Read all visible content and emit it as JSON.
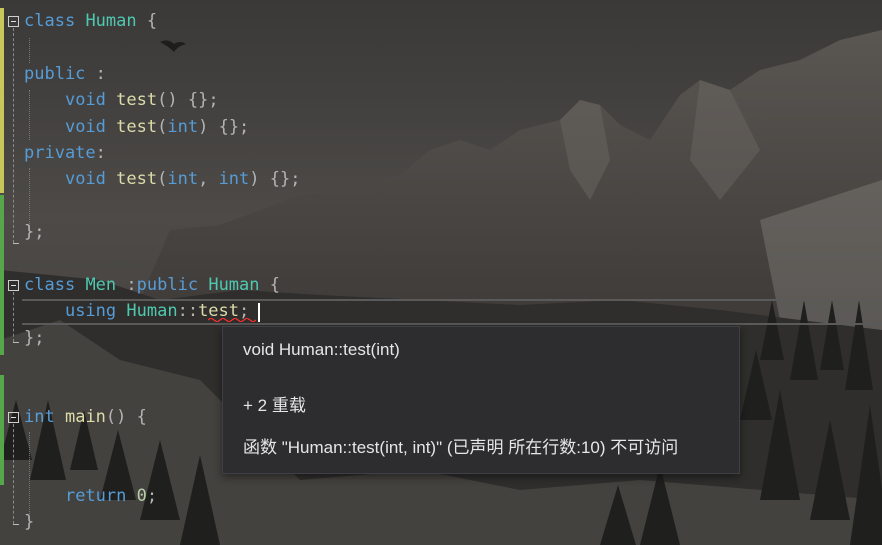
{
  "code": {
    "kw_class": "class",
    "kw_public": "public",
    "kw_private": "private",
    "kw_void": "void",
    "kw_int": "int",
    "kw_using": "using",
    "kw_return": "return",
    "type_human": "Human",
    "type_men": "Men",
    "fn_test": "test",
    "fn_main": "main",
    "num_zero": "0",
    "brace_open": "{",
    "brace_close": "};",
    "brace_close_plain": "}",
    "colon": ":",
    "space_colon": " :",
    "parens": "()",
    "paren_open": "(",
    "paren_close": ")",
    "comma": ", ",
    "empty_body": "{};",
    "scope": "::",
    "semicolon": ";"
  },
  "tooltip": {
    "signature": "void Human::test(int)",
    "overloads": "+ 2 重载",
    "error": "函数 \"Human::test(int, int)\" (已声明 所在行数:10) 不可访问"
  },
  "colors": {
    "keyword": "#569cd6",
    "type": "#4ec9b0",
    "function": "#dcdcaa",
    "number": "#b5cea8",
    "tooltip_bg": "#2d2d30",
    "margin_yellow": "#c8c85a",
    "margin_green": "#57a64a",
    "squiggle": "#ff3030"
  }
}
